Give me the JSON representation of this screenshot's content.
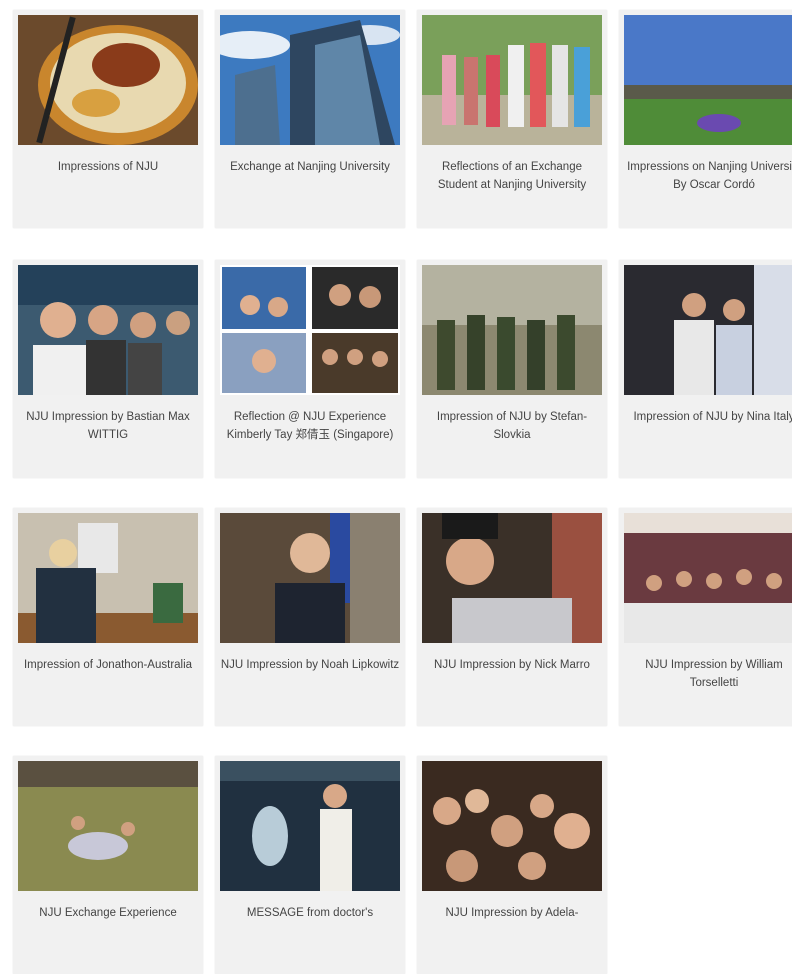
{
  "cards": [
    {
      "caption": "Impressions of NJU"
    },
    {
      "caption": "Exchange at Nanjing University"
    },
    {
      "caption": "Reflections of an Exchange Student at Nanjing University"
    },
    {
      "caption": "Impressions on Nanjing University By Oscar Cordó"
    },
    {
      "caption": "NJU Impression by Bastian Max WITTIG"
    },
    {
      "caption": "Reflection @ NJU Experience Kimberly Tay 郑倩玉 (Singapore)"
    },
    {
      "caption": "Impression of NJU by Stefan-Slovkia"
    },
    {
      "caption": "Impression of NJU by Nina Italy"
    },
    {
      "caption": "Impression of Jonathon-Australia"
    },
    {
      "caption": "NJU Impression by Noah Lipkowitz"
    },
    {
      "caption": "NJU Impression by Nick Marro"
    },
    {
      "caption": "NJU Impression by William Torselletti"
    },
    {
      "caption": "NJU Exchange Experience"
    },
    {
      "caption": "MESSAGE from doctor's"
    },
    {
      "caption": "NJU Impression by Adela-"
    }
  ]
}
